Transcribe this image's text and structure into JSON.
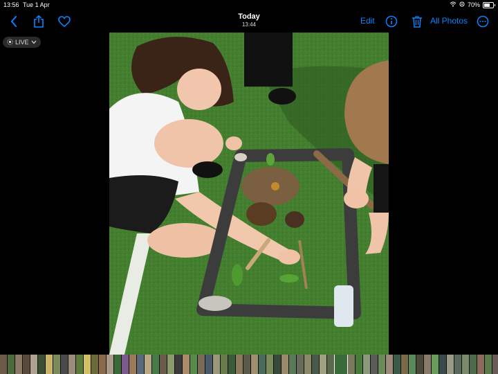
{
  "status_bar": {
    "time": "13:56",
    "date": "Tue 1 Apr",
    "battery": "70%",
    "battery_level": 0.7
  },
  "navbar": {
    "title": "Today",
    "subtitle": "13:44",
    "edit_label": "Edit",
    "all_photos_label": "All Photos",
    "accent_color": "#0a84ff",
    "icons": [
      "back-chevron-icon",
      "share-icon",
      "heart-icon",
      "info-icon",
      "trash-icon",
      "more-icon"
    ]
  },
  "live_badge": {
    "label": "LIVE"
  },
  "photo": {
    "selected_thumb_index": 44
  },
  "filmstrip": {
    "thumb_colors": [
      "#6b5a4a",
      "#4c6a3a",
      "#8c7a66",
      "#5a4a3a",
      "#b0a090",
      "#3a5030",
      "#c8b46a",
      "#7a8c5a",
      "#4a4a4a",
      "#9a8c7a",
      "#5b7a3a",
      "#d0c060",
      "#6a6a3a",
      "#8a6a4a",
      "#aa9a8a",
      "#3a6a3a",
      "#7a5a8a",
      "#9a7a5a",
      "#5a6a7a",
      "#b8a888",
      "#4a7a4a",
      "#6a5a4a",
      "#8a9a6a",
      "#3a3a3a",
      "#aa8a6a",
      "#5a8a4a",
      "#7a6a5a",
      "#4a5a6a",
      "#9a9a7a",
      "#6a7a4a",
      "#3a5a3a",
      "#8a7a5a",
      "#5a5a4a",
      "#a09070",
      "#4a6a5a",
      "#7a8a5a",
      "#3a4a3a",
      "#9a8a6a",
      "#5a7a5a",
      "#6a6a5a",
      "#8a8a6a",
      "#4a5a4a",
      "#a0a080",
      "#5a6a4a",
      "#3a6a3a",
      "#7a7a5a",
      "#4a7a3a",
      "#8a9a7a",
      "#5a5a5a",
      "#6a8a5a",
      "#9a8a7a",
      "#3a5a4a",
      "#7a6a4a",
      "#5a8a5a",
      "#4a4a3a",
      "#8a7a6a",
      "#6a9a5a",
      "#3a4a4a",
      "#9a9a8a",
      "#5a6a5a",
      "#7a8a6a",
      "#4a6a4a",
      "#8a6a5a",
      "#5a7a4a",
      "#6a5a5a",
      "#aa9a7a"
    ]
  }
}
